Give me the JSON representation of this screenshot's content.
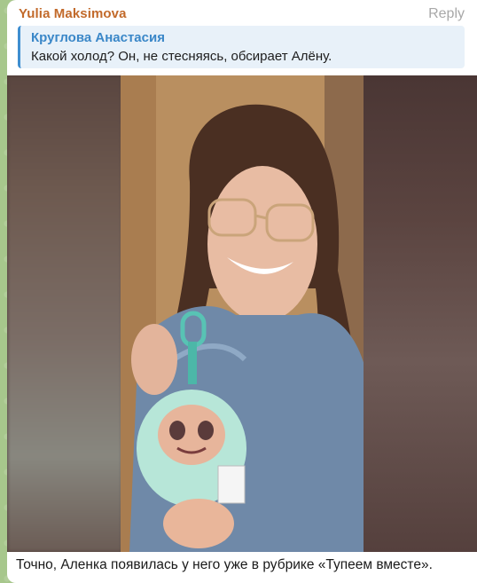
{
  "message": {
    "sender": "Yulia Maksimova",
    "reply_label": "Reply",
    "quote": {
      "author": "Круглова Анастасия",
      "text": "Какой холод? Он, не стесняясь, обсирает Алёну."
    },
    "caption": "Точно, Аленка появилась у него уже в рубрике «Тупеем вместе»."
  },
  "colors": {
    "sender_name": "#c26a2b",
    "quote_accent": "#3e8ed0",
    "quote_background": "#e8f1f9",
    "chat_background": "#a7c78c"
  }
}
